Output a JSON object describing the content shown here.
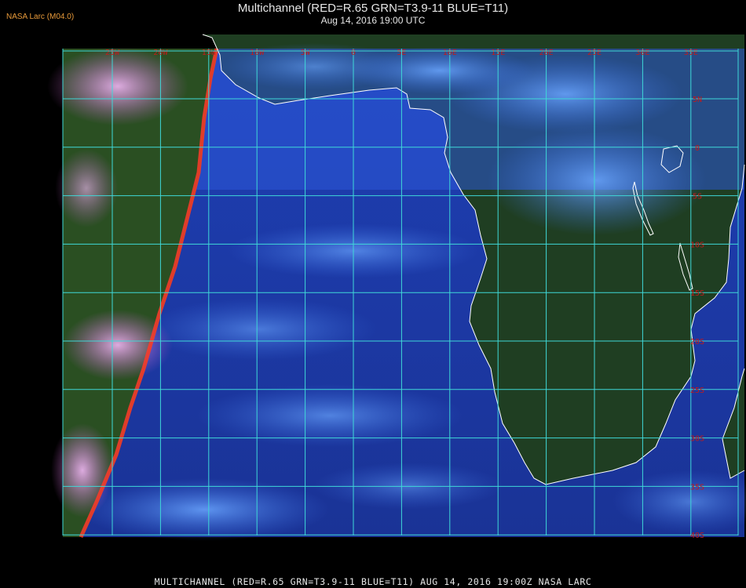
{
  "header": {
    "credit": "NASA Larc (M04.0)",
    "title": "Multichannel (RED=R.65 GRN=T3.9-11 BLUE=T11)",
    "subtitle": "Aug 14, 2016 19:00 UTC"
  },
  "footer": {
    "caption": "MULTICHANNEL (RED=R.65 GRN=T3.9-11 BLUE=T11) AUG 14, 2016 19:00Z   NASA LARC"
  },
  "grid": {
    "lon_labels": [
      "25W",
      "20W",
      "15W",
      "10W",
      "5W",
      "0",
      "5E",
      "10E",
      "15E",
      "20E",
      "25E",
      "30E",
      "35E"
    ],
    "lat_labels": [
      "5N",
      "0",
      "5S",
      "10S",
      "15S",
      "20S",
      "25S",
      "30S",
      "35S",
      "40S"
    ]
  },
  "colors": {
    "grid_line": "#3fd8d8",
    "grid_label": "#c41a1a",
    "ocean": "#1c36a8",
    "land": "#1e3d20",
    "cloud": "#4f8cf0",
    "terminator": "#ff3a2a",
    "day_cloud": "#e07ae6",
    "coastline": "#ffffff"
  }
}
